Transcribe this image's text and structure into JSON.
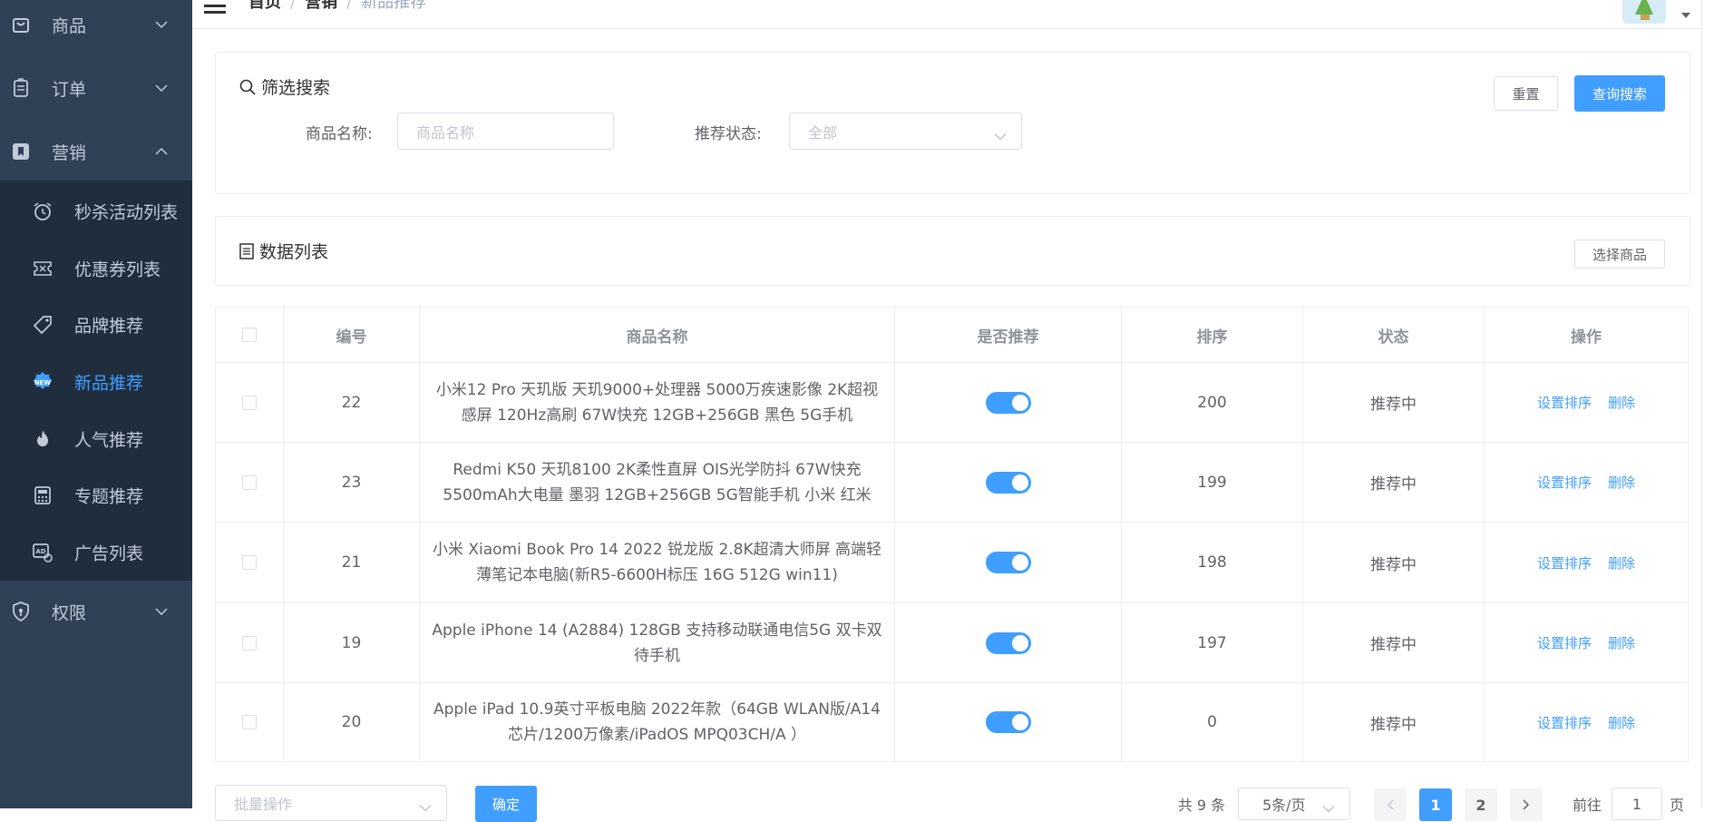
{
  "sidebar": {
    "menus": [
      {
        "label": "商品",
        "icon": "bag-icon"
      },
      {
        "label": "订单",
        "icon": "clipboard-icon"
      },
      {
        "label": "营销",
        "icon": "bookmark-icon"
      },
      {
        "label": "权限",
        "icon": "shield-icon"
      }
    ],
    "submenu": [
      {
        "label": "秒杀活动列表",
        "icon": "alarm-clock-icon"
      },
      {
        "label": "优惠券列表",
        "icon": "coupon-icon"
      },
      {
        "label": "品牌推荐",
        "icon": "tag-icon"
      },
      {
        "label": "新品推荐",
        "icon": "new-badge-icon",
        "active": true
      },
      {
        "label": "人气推荐",
        "icon": "fire-icon"
      },
      {
        "label": "专题推荐",
        "icon": "calculator-icon"
      },
      {
        "label": "广告列表",
        "icon": "ad-icon"
      }
    ]
  },
  "header": {
    "breadcrumb": [
      "首页",
      "营销",
      "新品推荐"
    ]
  },
  "filter": {
    "title": "筛选搜索",
    "reset_label": "重置",
    "search_label": "查询搜索",
    "name_label": "商品名称:",
    "name_placeholder": "商品名称",
    "status_label": "推荐状态:",
    "status_value": "全部"
  },
  "list": {
    "title": "数据列表",
    "select_product_label": "选择商品"
  },
  "table": {
    "headers": [
      "编号",
      "商品名称",
      "是否推荐",
      "排序",
      "状态",
      "操作"
    ],
    "rows": [
      {
        "id": "22",
        "name": "小米12 Pro 天玑版 天玑9000+处理器 5000万疾速影像 2K超视感屏 120Hz高刷 67W快充 12GB+256GB 黑色 5G手机",
        "recommended": true,
        "sort": "200",
        "status": "推荐中"
      },
      {
        "id": "23",
        "name": "Redmi K50 天玑8100 2K柔性直屏 OIS光学防抖 67W快充 5500mAh大电量 墨羽 12GB+256GB 5G智能手机 小米 红米",
        "recommended": true,
        "sort": "199",
        "status": "推荐中"
      },
      {
        "id": "21",
        "name": "小米 Xiaomi Book Pro 14 2022 锐龙版 2.8K超清大师屏 高端轻薄笔记本电脑(新R5-6600H标压 16G 512G win11)",
        "recommended": true,
        "sort": "198",
        "status": "推荐中"
      },
      {
        "id": "19",
        "name": "Apple iPhone 14 (A2884) 128GB 支持移动联通电信5G 双卡双待手机",
        "recommended": true,
        "sort": "197",
        "status": "推荐中"
      },
      {
        "id": "20",
        "name": "Apple iPad 10.9英寸平板电脑 2022年款（64GB WLAN版/A14芯片/1200万像素/iPadOS MPQ03CH/A ）",
        "recommended": true,
        "sort": "0",
        "status": "推荐中"
      }
    ],
    "action_sort": "设置排序",
    "action_delete": "删除"
  },
  "footer": {
    "batch_placeholder": "批量操作",
    "confirm_label": "确定",
    "total_text": "共 9 条",
    "page_size": "5条/页",
    "pages": [
      "1",
      "2"
    ],
    "current_page": "1",
    "goto_prefix": "前往",
    "goto_value": "1",
    "goto_suffix": "页"
  },
  "colors": {
    "sidebar_bg": "#304156",
    "submenu_bg": "#1f2d3d",
    "primary": "#409eff"
  }
}
